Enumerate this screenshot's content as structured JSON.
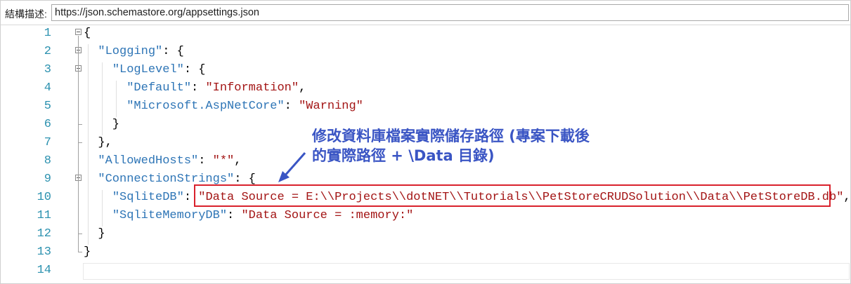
{
  "schema_bar": {
    "label": "結構描述:",
    "value": "https://json.schemastore.org/appsettings.json"
  },
  "editor": {
    "line_numbers": [
      "1",
      "2",
      "3",
      "4",
      "5",
      "6",
      "7",
      "8",
      "9",
      "10",
      "11",
      "12",
      "13",
      "14"
    ],
    "lines": [
      {
        "tokens": [
          {
            "t": "punct",
            "v": "{"
          }
        ]
      },
      {
        "tokens": [
          {
            "t": "punct",
            "v": "  "
          },
          {
            "t": "key",
            "v": "\"Logging\""
          },
          {
            "t": "punct",
            "v": ": {"
          }
        ]
      },
      {
        "tokens": [
          {
            "t": "punct",
            "v": "    "
          },
          {
            "t": "key",
            "v": "\"LogLevel\""
          },
          {
            "t": "punct",
            "v": ": {"
          }
        ]
      },
      {
        "tokens": [
          {
            "t": "punct",
            "v": "      "
          },
          {
            "t": "key",
            "v": "\"Default\""
          },
          {
            "t": "punct",
            "v": ": "
          },
          {
            "t": "str",
            "v": "\"Information\""
          },
          {
            "t": "punct",
            "v": ","
          }
        ]
      },
      {
        "tokens": [
          {
            "t": "punct",
            "v": "      "
          },
          {
            "t": "key",
            "v": "\"Microsoft.AspNetCore\""
          },
          {
            "t": "punct",
            "v": ": "
          },
          {
            "t": "str",
            "v": "\"Warning\""
          }
        ]
      },
      {
        "tokens": [
          {
            "t": "punct",
            "v": "    }"
          }
        ]
      },
      {
        "tokens": [
          {
            "t": "punct",
            "v": "  },"
          }
        ]
      },
      {
        "tokens": [
          {
            "t": "punct",
            "v": "  "
          },
          {
            "t": "key",
            "v": "\"AllowedHosts\""
          },
          {
            "t": "punct",
            "v": ": "
          },
          {
            "t": "str",
            "v": "\"*\""
          },
          {
            "t": "punct",
            "v": ","
          }
        ]
      },
      {
        "tokens": [
          {
            "t": "punct",
            "v": "  "
          },
          {
            "t": "key",
            "v": "\"ConnectionStrings\""
          },
          {
            "t": "punct",
            "v": ": {"
          }
        ]
      },
      {
        "tokens": [
          {
            "t": "punct",
            "v": "    "
          },
          {
            "t": "key",
            "v": "\"SqliteDB\""
          },
          {
            "t": "punct",
            "v": ": "
          },
          {
            "t": "str",
            "v": "\"Data Source = E:\\\\Projects\\\\dotNET\\\\Tutorials\\\\PetStoreCRUDSolution\\\\Data\\\\PetStoreDB.db\""
          },
          {
            "t": "punct",
            "v": ","
          }
        ]
      },
      {
        "tokens": [
          {
            "t": "punct",
            "v": "    "
          },
          {
            "t": "key",
            "v": "\"SqliteMemoryDB\""
          },
          {
            "t": "punct",
            "v": ": "
          },
          {
            "t": "str",
            "v": "\"Data Source = :memory:\""
          }
        ]
      },
      {
        "tokens": [
          {
            "t": "punct",
            "v": "  }"
          }
        ]
      },
      {
        "tokens": [
          {
            "t": "punct",
            "v": "}"
          }
        ]
      },
      {
        "tokens": []
      }
    ]
  },
  "annotation": {
    "line1": "修改資料庫檔案實際儲存路徑 (專案下載後",
    "line2": "的實際路徑 + \\Data 目錄)"
  },
  "colors": {
    "key": "#2e75b6",
    "string": "#a31515",
    "line_number": "#2b91af",
    "highlight_box": "#d9212c",
    "annotation": "#3a55c4"
  }
}
